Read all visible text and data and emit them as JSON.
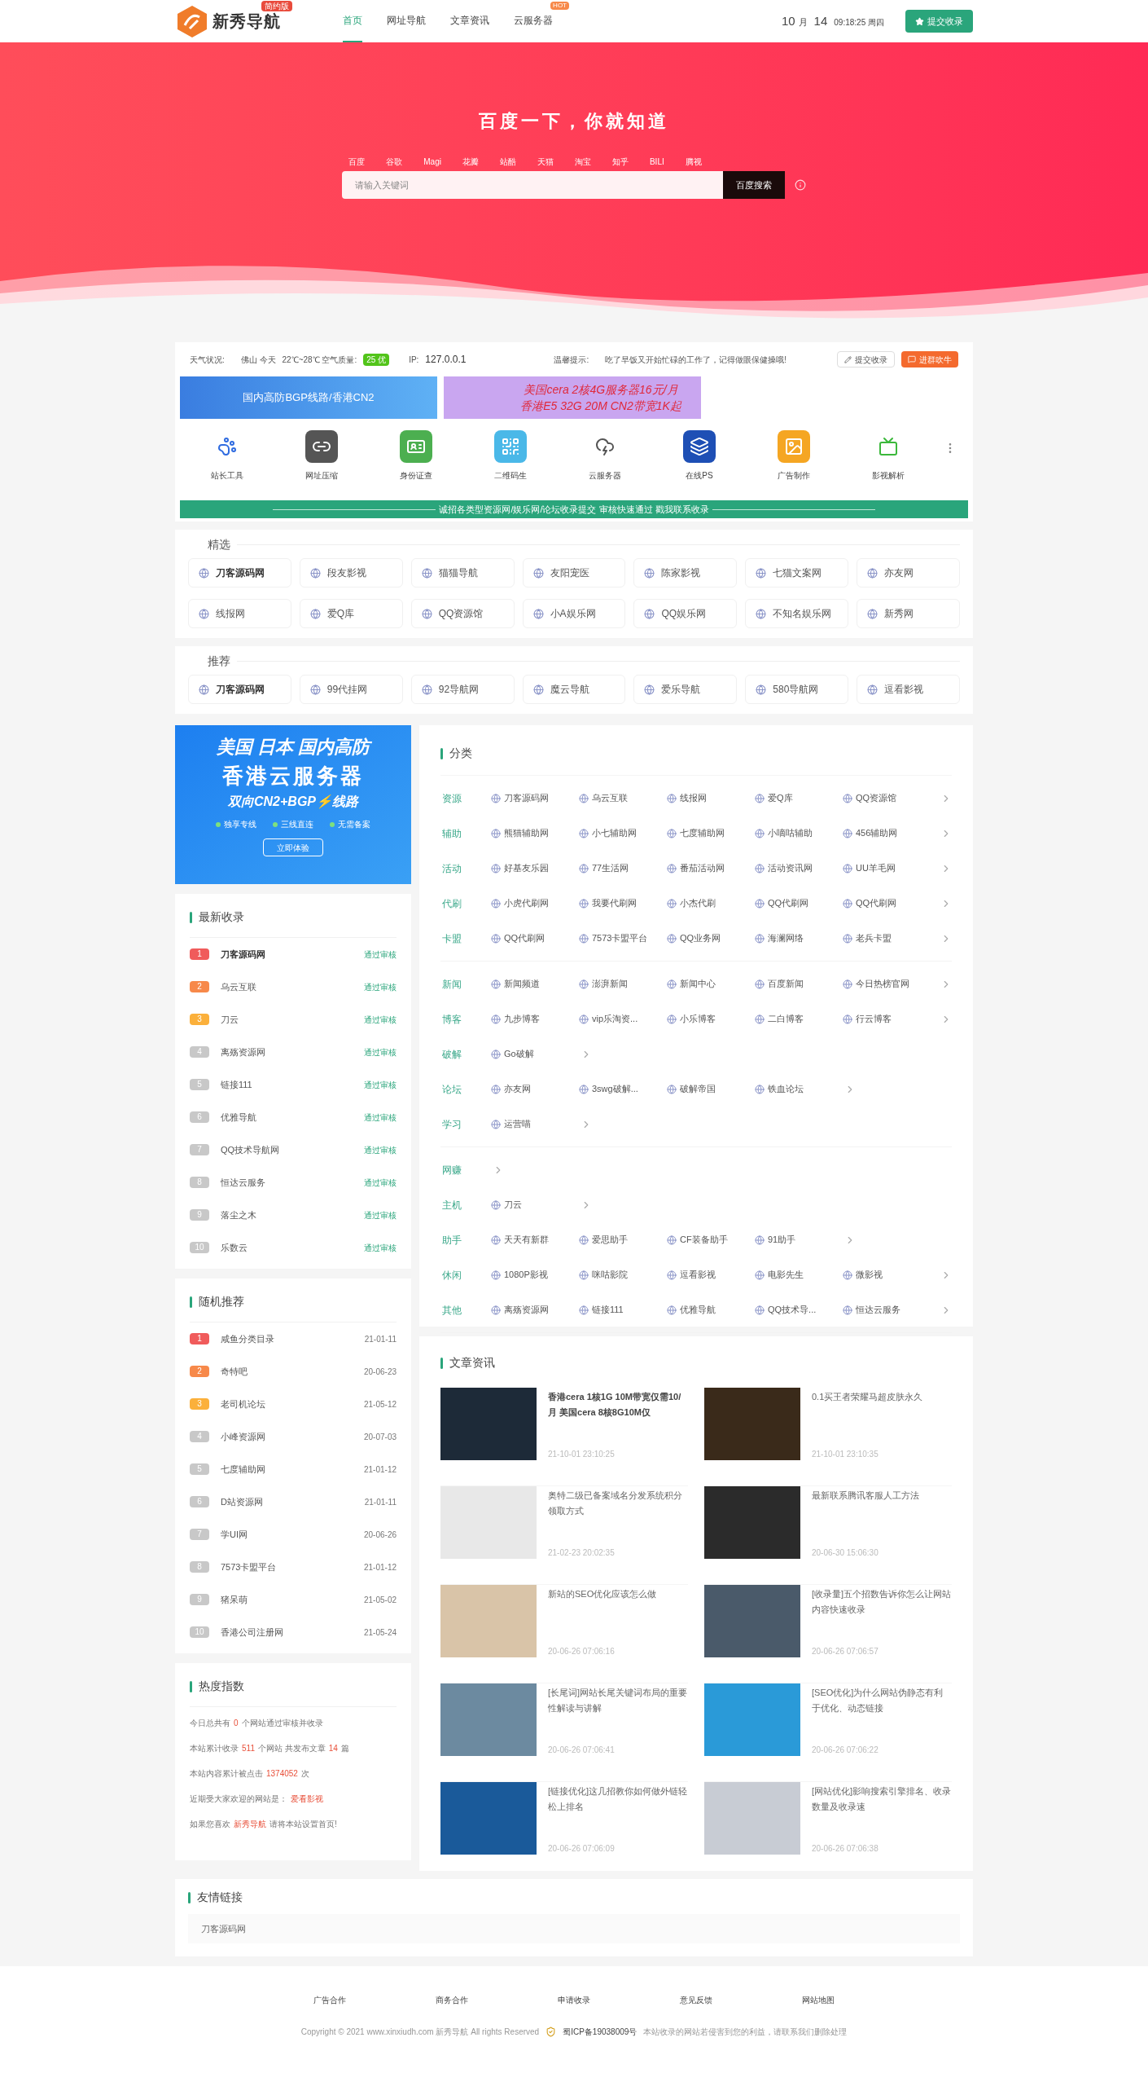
{
  "header": {
    "logo": "新秀导航",
    "logo_badge": "简约版",
    "nav": [
      {
        "label": "首页",
        "selected": true
      },
      {
        "label": "网址导航",
        "selected": false
      },
      {
        "label": "文章资讯",
        "selected": false
      },
      {
        "label": "云服务器",
        "selected": false,
        "badge": "HOT"
      }
    ],
    "date": {
      "month": "10",
      "month_unit": "月",
      "day": "14",
      "time": "09:18:25 周四"
    },
    "submit": "提交收录"
  },
  "hero": {
    "title": "百度一下，你就知道",
    "engines": [
      "百度",
      "谷歌",
      "Magi",
      "花瓣",
      "站酷",
      "天猫",
      "淘宝",
      "知乎",
      "BILI",
      "腾视"
    ],
    "placeholder": "请输入关键词",
    "button": "百度搜索"
  },
  "info": {
    "weather_label": "天气状况:",
    "weather": "佛山 今天",
    "temp": "22℃~28℃ 空气质量:",
    "aqi": "25 优",
    "ip_label": "IP:",
    "ip": "127.0.0.1",
    "tip_label": "温馨提示:",
    "tip": "吃了早饭又开始忙碌的工作了，记得做眼保健操哦!",
    "buttons": [
      {
        "label": "提交收录",
        "kind": "outline"
      },
      {
        "label": "进群吹牛",
        "kind": "filled"
      }
    ]
  },
  "banners": [
    {
      "lines": [
        "国内高防BGP线路/香港CN2"
      ],
      "kind": "blue"
    },
    {
      "lines": [
        "美国cera 2核4G服务器16元/月",
        "香港E5 32G 20M CN2带宽1K起"
      ],
      "kind": "purple"
    }
  ],
  "tools": [
    {
      "label": "站长工具",
      "kind": "paw"
    },
    {
      "label": "网址压缩",
      "kind": "link"
    },
    {
      "label": "身份证查",
      "kind": "idcard"
    },
    {
      "label": "二维码生",
      "kind": "qrcode"
    },
    {
      "label": "云服务器",
      "kind": "cloud"
    },
    {
      "label": "在线PS",
      "kind": "ps"
    },
    {
      "label": "广告制作",
      "kind": "image"
    },
    {
      "label": "影视解析",
      "kind": "video"
    }
  ],
  "notice": "诚招各类型资源网/娱乐网/论坛收录提交 审核快速通过 戳我联系收录",
  "featured": {
    "title": "精选",
    "items": [
      {
        "name": "刀客源码网",
        "highlighted": true
      },
      {
        "name": "段友影视",
        "highlighted": false
      },
      {
        "name": "猫猫导航",
        "highlighted": false
      },
      {
        "name": "友阳宠医",
        "highlighted": false
      },
      {
        "name": "陈家影视",
        "highlighted": false
      },
      {
        "name": "七猫文案网",
        "highlighted": false
      },
      {
        "name": "亦友网",
        "highlighted": false
      },
      {
        "name": "线报网",
        "highlighted": false
      },
      {
        "name": "爱Q库",
        "highlighted": false
      },
      {
        "name": "QQ资源馆",
        "highlighted": false
      },
      {
        "name": "小A娱乐网",
        "highlighted": false
      },
      {
        "name": "QQ娱乐网",
        "highlighted": false
      },
      {
        "name": "不知名娱乐网",
        "highlighted": false
      },
      {
        "name": "新秀网",
        "highlighted": false
      }
    ]
  },
  "recommend": {
    "title": "推荐",
    "items": [
      {
        "name": "刀客源码网",
        "highlighted": true
      },
      {
        "name": "99代挂网",
        "highlighted": false
      },
      {
        "name": "92导航网",
        "highlighted": false
      },
      {
        "name": "魔云导航",
        "highlighted": false
      },
      {
        "name": "爱乐导航",
        "highlighted": false
      },
      {
        "name": "580导航网",
        "highlighted": false
      },
      {
        "name": "逗看影视",
        "highlighted": false
      }
    ]
  },
  "ad": {
    "line1": "美国 日本 国内高防",
    "line2": "香港云服务器",
    "line3": "双向CN2+BGP⚡线路",
    "features": [
      "独享专线",
      "三线直连",
      "无需备案"
    ],
    "button": "立即体验"
  },
  "latest": {
    "title": "最新收录",
    "items": [
      {
        "rank": "1",
        "color": "#f05b5b",
        "name": "刀客源码网",
        "highlighted": true,
        "status": "通过审核"
      },
      {
        "rank": "2",
        "color": "#f7894a",
        "name": "乌云互联",
        "highlighted": false,
        "status": "通过审核"
      },
      {
        "rank": "3",
        "color": "#fbb03b",
        "name": "刀云",
        "highlighted": false,
        "status": "通过审核"
      },
      {
        "rank": "4",
        "color": "#c8c8c8",
        "name": "离殇资源网",
        "highlighted": false,
        "status": "通过审核"
      },
      {
        "rank": "5",
        "color": "#c8c8c8",
        "name": "链接111",
        "highlighted": false,
        "status": "通过审核"
      },
      {
        "rank": "6",
        "color": "#c8c8c8",
        "name": "优雅导航",
        "highlighted": false,
        "status": "通过审核"
      },
      {
        "rank": "7",
        "color": "#c8c8c8",
        "name": "QQ技术导航网",
        "highlighted": false,
        "status": "通过审核"
      },
      {
        "rank": "8",
        "color": "#c8c8c8",
        "name": "恒达云服务",
        "highlighted": false,
        "status": "通过审核"
      },
      {
        "rank": "9",
        "color": "#c8c8c8",
        "name": "落尘之木",
        "highlighted": false,
        "status": "通过审核"
      },
      {
        "rank": "10",
        "color": "#c8c8c8",
        "name": "乐数云",
        "highlighted": false,
        "status": "通过审核"
      }
    ]
  },
  "random": {
    "title": "随机推荐",
    "items": [
      {
        "rank": "1",
        "color": "#f05b5b",
        "name": "咸鱼分类目录",
        "date": "21-01-11"
      },
      {
        "rank": "2",
        "color": "#f7894a",
        "name": "奇特吧",
        "date": "20-06-23"
      },
      {
        "rank": "3",
        "color": "#fbb03b",
        "name": "老司机论坛",
        "date": "21-05-12"
      },
      {
        "rank": "4",
        "color": "#c8c8c8",
        "name": "小峰资源网",
        "date": "20-07-03"
      },
      {
        "rank": "5",
        "color": "#c8c8c8",
        "name": "七度辅助网",
        "date": "21-01-12"
      },
      {
        "rank": "6",
        "color": "#c8c8c8",
        "name": "D站资源网",
        "date": "21-01-11"
      },
      {
        "rank": "7",
        "color": "#c8c8c8",
        "name": "学UI网",
        "date": "20-06-26"
      },
      {
        "rank": "8",
        "color": "#c8c8c8",
        "name": "7573卡盟平台",
        "date": "21-01-12"
      },
      {
        "rank": "9",
        "color": "#c8c8c8",
        "name": "猪呆萌",
        "date": "21-05-02"
      },
      {
        "rank": "10",
        "color": "#c8c8c8",
        "name": "香港公司注册网",
        "date": "21-05-24"
      }
    ]
  },
  "heat": {
    "title": "热度指数",
    "lines": [
      [
        {
          "text": "今日总共有",
          "highlight": false
        },
        {
          "text": "0",
          "highlight": true
        },
        {
          "text": "个网站通过审核并收录",
          "highlight": false
        }
      ],
      [
        {
          "text": "本站累计收录",
          "highlight": false
        },
        {
          "text": "511",
          "highlight": true
        },
        {
          "text": "个网站 共发布文章",
          "highlight": false
        },
        {
          "text": "14",
          "highlight": true
        },
        {
          "text": "篇",
          "highlight": false
        }
      ],
      [
        {
          "text": "本站内容累计被点击",
          "highlight": false
        },
        {
          "text": "1374052",
          "highlight": true
        },
        {
          "text": "次",
          "highlight": false
        }
      ],
      [
        {
          "text": "近期受大家欢迎的网站是：",
          "highlight": false
        },
        {
          "text": "爱看影视",
          "highlight": true
        }
      ],
      [
        {
          "text": "如果您喜欢",
          "highlight": false
        },
        {
          "text": "新秀导航",
          "highlight": true
        },
        {
          "text": "请将本站设置首页!",
          "highlight": false
        }
      ]
    ]
  },
  "categories": {
    "title": "分类",
    "groups": [
      [
        {
          "label": "资源",
          "links": [
            "刀客源码网",
            "乌云互联",
            "线报网",
            "爱Q库",
            "QQ资源馆"
          ]
        },
        {
          "label": "辅助",
          "links": [
            "熊猫辅助网",
            "小七辅助网",
            "七度辅助网",
            "小嘀咕辅助",
            "456辅助网"
          ]
        },
        {
          "label": "活动",
          "links": [
            "好基友乐园",
            "77生活网",
            "番茄活动网",
            "活动资讯网",
            "UU羊毛网"
          ]
        },
        {
          "label": "代刷",
          "links": [
            "小虎代刷网",
            "我要代刷网",
            "小杰代刷",
            "QQ代刷网",
            "QQ代刷网"
          ]
        },
        {
          "label": "卡盟",
          "links": [
            "QQ代刷网",
            "7573卡盟平台",
            "QQ业务网",
            "海澜网络",
            "老兵卡盟"
          ]
        }
      ],
      [
        {
          "label": "新闻",
          "links": [
            "新闻频道",
            "澎湃新闻",
            "新闻中心",
            "百度新闻",
            "今日热榜官网"
          ]
        },
        {
          "label": "博客",
          "links": [
            "九步博客",
            "vip乐淘资...",
            "小乐博客",
            "二白博客",
            "行云博客"
          ]
        },
        {
          "label": "破解",
          "links": [
            "Go破解"
          ]
        },
        {
          "label": "论坛",
          "links": [
            "亦友网",
            "3swg破解...",
            "破解帝国",
            "铁血论坛"
          ]
        },
        {
          "label": "学习",
          "links": [
            "运营喵"
          ]
        }
      ],
      [
        {
          "label": "网赚"
        },
        {
          "label": "主机",
          "links": [
            "刀云"
          ]
        },
        {
          "label": "助手",
          "links": [
            "天天有新群",
            "爱思助手",
            "CF装备助手",
            "91助手"
          ]
        },
        {
          "label": "休闲",
          "links": [
            "1080P影视",
            "咪咕影院",
            "逗看影视",
            "电影先生",
            "微影视"
          ]
        },
        {
          "label": "其他",
          "links": [
            "离殇资源网",
            "链接111",
            "优雅导航",
            "QQ技术导...",
            "恒达云服务"
          ]
        }
      ]
    ]
  },
  "articles": {
    "title": "文章资讯",
    "items": [
      {
        "title": "香港cera 1核1G 10M带宽仅需10/月 美国cera 8核8G10M仅",
        "date": "21-10-01 23:10:25",
        "highlighted": true
      },
      {
        "title": "0.1买王者荣耀马超皮肤永久",
        "date": "21-10-01 23:10:35",
        "highlighted": false
      },
      {
        "title": "奥特二级已备案域名分发系统积分领取方式",
        "date": "21-02-23 20:02:35",
        "highlighted": false
      },
      {
        "title": "最新联系腾讯客服人工方法",
        "date": "20-06-30 15:06:30",
        "highlighted": false
      },
      {
        "title": "新站的SEO优化应该怎么做",
        "date": "20-06-26 07:06:16",
        "highlighted": false
      },
      {
        "title": "[收录量]五个招数告诉你怎么让网站内容快速收录",
        "date": "20-06-26 07:06:57",
        "highlighted": false
      },
      {
        "title": "[长尾词]网站长尾关键词布局的重要性解读与讲解",
        "date": "20-06-26 07:06:41",
        "highlighted": false
      },
      {
        "title": "[SEO优化]为什么网站伪静态有利于优化、动态链接",
        "date": "20-06-26 07:06:22",
        "highlighted": false
      },
      {
        "title": "[链接优化]这几招教你如何做外链轻松上排名",
        "date": "20-06-26 07:06:09",
        "highlighted": false
      },
      {
        "title": "[网站优化]影响搜索引擎排名、收录数量及收录速",
        "date": "20-06-26 07:06:38",
        "highlighted": false
      }
    ]
  },
  "friends": {
    "title": "友情链接",
    "links": [
      "刀客源码网"
    ]
  },
  "footer": {
    "links": [
      "广告合作",
      "商务合作",
      "申请收录",
      "意见反馈",
      "网站地图"
    ],
    "copyright": "Copyright © 2021 www.xinxiudh.com 新秀导航 All rights Reserved",
    "icp": "蜀ICP备19038009号",
    "note": "本站收录的网站若侵害到您的利益，请联系我们删除处理"
  }
}
